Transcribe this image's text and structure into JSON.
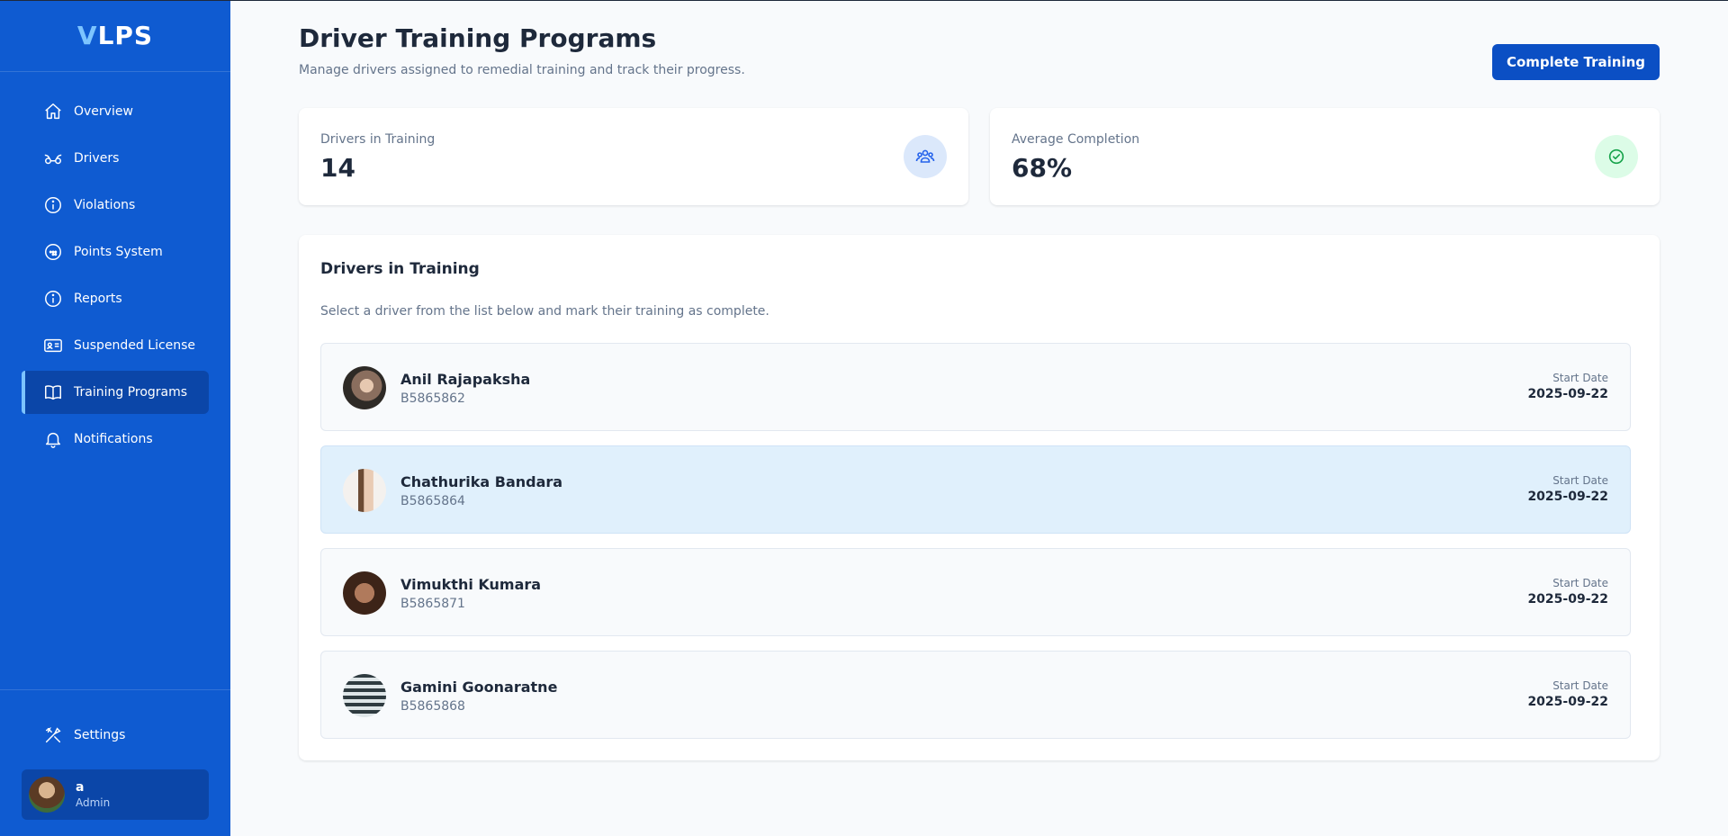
{
  "brand": {
    "first": "V",
    "rest": "LPS"
  },
  "sidebar": {
    "items": [
      {
        "label": "Overview",
        "icon": "home-icon"
      },
      {
        "label": "Drivers",
        "icon": "drivers-icon"
      },
      {
        "label": "Violations",
        "icon": "info-icon"
      },
      {
        "label": "Points System",
        "icon": "points-icon"
      },
      {
        "label": "Reports",
        "icon": "info-icon"
      },
      {
        "label": "Suspended License",
        "icon": "id-card-icon"
      },
      {
        "label": "Training Programs",
        "icon": "book-icon",
        "active": true
      },
      {
        "label": "Notifications",
        "icon": "bell-icon"
      }
    ],
    "settings_label": "Settings",
    "user": {
      "name": "a",
      "role": "Admin"
    }
  },
  "header": {
    "title": "Driver Training Programs",
    "subtitle": "Manage drivers assigned to remedial training and track their progress.",
    "action_label": "Complete Training"
  },
  "stats": [
    {
      "label": "Drivers in Training",
      "value": "14",
      "icon": "users-icon",
      "accent": "#dbe8fb"
    },
    {
      "label": "Average Completion",
      "value": "68%",
      "icon": "check-circle-icon",
      "accent": "#dcfce7"
    }
  ],
  "panel": {
    "title": "Drivers in Training",
    "subtitle": "Select a driver from the list below and mark their training as complete.",
    "date_label": "Start Date",
    "drivers": [
      {
        "name": "Anil Rajapaksha",
        "id": "B5865862",
        "start_date": "2025-09-22",
        "selected": false
      },
      {
        "name": "Chathurika Bandara",
        "id": "B5865864",
        "start_date": "2025-09-22",
        "selected": true
      },
      {
        "name": "Vimukthi Kumara",
        "id": "B5865871",
        "start_date": "2025-09-22",
        "selected": false
      },
      {
        "name": "Gamini Goonaratne",
        "id": "B5865868",
        "start_date": "2025-09-22",
        "selected": false
      }
    ]
  },
  "colors": {
    "sidebar_bg": "#0f5bd1",
    "sidebar_active": "#0b46a8",
    "primary": "#0b4fc4",
    "selected_row": "#e0f0fc"
  }
}
